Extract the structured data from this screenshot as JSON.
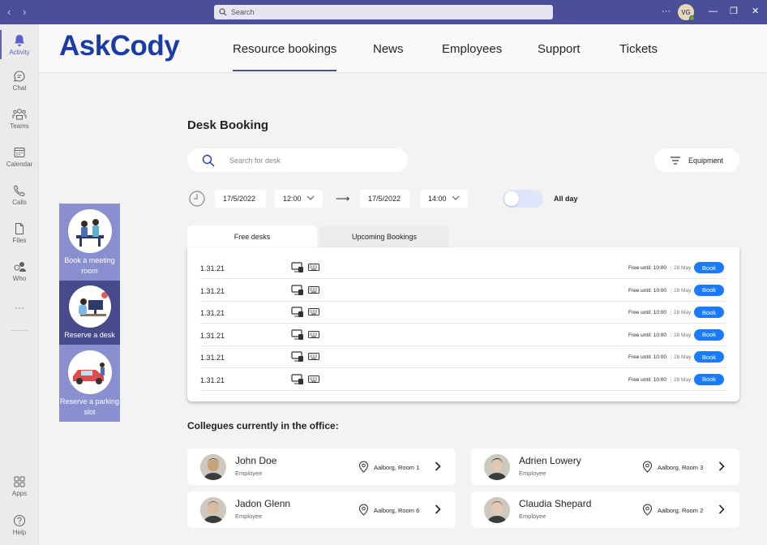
{
  "titlebar": {
    "back": "‹",
    "forward": "›",
    "search_placeholder": "Search",
    "more": "···",
    "avatar_initials": "VG",
    "minimize": "—",
    "restore": "❐",
    "close": "✕"
  },
  "rail": [
    {
      "label": "Activity",
      "icon": "bell-icon"
    },
    {
      "label": "Chat",
      "icon": "chat-icon"
    },
    {
      "label": "Teams",
      "icon": "teams-icon"
    },
    {
      "label": "Calendar",
      "icon": "calendar-icon"
    },
    {
      "label": "Calls",
      "icon": "phone-icon"
    },
    {
      "label": "Files",
      "icon": "file-icon"
    },
    {
      "label": "Who",
      "icon": "who-icon"
    },
    {
      "label": "···",
      "icon": "more-icon"
    },
    {
      "label": "Apps",
      "icon": "apps-icon"
    },
    {
      "label": "Help",
      "icon": "help-icon"
    }
  ],
  "header": {
    "logo": "AskCody",
    "tabs": [
      "Resource bookings",
      "News",
      "Employees",
      "Support",
      "Tickets"
    ],
    "active_tab": "Resource bookings"
  },
  "side_cards": [
    {
      "label": "Book a meeting room"
    },
    {
      "label": "Reserve a desk"
    },
    {
      "label": "Reserve a parking slot"
    }
  ],
  "booking": {
    "title": "Desk Booking",
    "search_placeholder": "Search for desk",
    "equipment_label": "Equipment",
    "start_date": "17/5/2022",
    "start_time": "12:00",
    "arrow": "⟶",
    "end_date": "17/5/2022",
    "end_time": "14:00",
    "all_day_label": "All day",
    "all_day_on": false,
    "tabs": [
      "Free desks",
      "Upcoming Bookings"
    ],
    "active_tab": "Free desks",
    "rows": [
      {
        "code": "1.31.21",
        "free": "Free until: 10:00",
        "date": "28 May",
        "book": "Book"
      },
      {
        "code": "1.31.21",
        "free": "Free until: 10:00",
        "date": "28 May",
        "book": "Book"
      },
      {
        "code": "1.31.21",
        "free": "Free until: 10:00",
        "date": "28 May",
        "book": "Book"
      },
      {
        "code": "1.31.21",
        "free": "Free until: 10:00",
        "date": "28 May",
        "book": "Book"
      },
      {
        "code": "1.31.21",
        "free": "Free until: 10:00",
        "date": "28 May",
        "book": "Book"
      },
      {
        "code": "1.31.21",
        "free": "Free until: 10:00",
        "date": "28 May",
        "book": "Book"
      }
    ]
  },
  "colleagues": {
    "title": "Collegues currently in the office:",
    "people": [
      {
        "name": "John Doe",
        "role": "Employee",
        "location": "Aalborg, Room 1"
      },
      {
        "name": "Adrien Lowery",
        "role": "Employee",
        "location": "Aalborg, Room 3"
      },
      {
        "name": "Jadon Glenn",
        "role": "Employee",
        "location": "Aalborg, Room 6"
      },
      {
        "name": "Claudia Shepard",
        "role": "Employee",
        "location": "Aalborg, Room 2"
      }
    ]
  },
  "colors": {
    "titlebar": "#4b4f99",
    "accent": "#5b5fc7",
    "logo": "#1b3ba8",
    "book_button": "#1a7bff",
    "card_light": "#8a8fcf",
    "card_dark": "#474b8c"
  }
}
